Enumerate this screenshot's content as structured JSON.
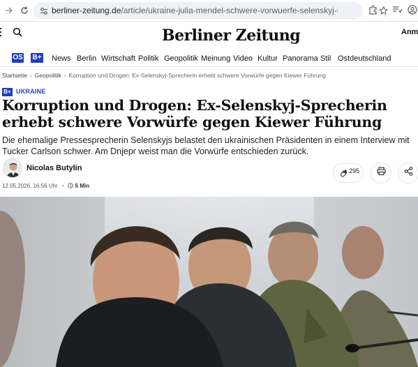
{
  "browser": {
    "url_host": "berliner-zeitung.de",
    "url_path": "/article/ukraine-julia-mendel-schwere-vorwuerfe-selenskyj-tucker-carlson-int..."
  },
  "site": {
    "logo": "Berliner Zeitung",
    "login_label": "Anme"
  },
  "nav": {
    "badge_os": "OS",
    "badge_b": "B+",
    "items": [
      "News",
      "Berlin",
      "Wirtschaft",
      "Politik",
      "Geopolitik",
      "Meinung",
      "Video",
      "Kultur",
      "Panorama",
      "Stil",
      "Ostdeutschland"
    ]
  },
  "breadcrumb": {
    "home": "Startseite",
    "section": "Geopolitik",
    "current": "Korruption und Drogen: Ex-Selenskyj-Sprecherin erhebt schwere Vorwürfe gegen Kiewer Führung"
  },
  "article": {
    "kicker_badge": "B+",
    "kicker": "UKRAINE",
    "headline": "Korruption und Drogen: Ex-Selenskyj-Sprecherin erhebt schwere Vorwürfe gegen Kiewer Führung",
    "teaser": "Die ehemalige Pressesprecherin Selenskyjs belastet den ukrainischen Präsidenten in einem Interview mit Tucker Carlson schwer. Am Dnjepr weist man die Vorwürfe entschieden zurück.",
    "author": "Nicolas Butylin",
    "claps": "295",
    "date": "12.05.2026, 16:56 Uhr",
    "read_time": "5 Min"
  },
  "colors": {
    "brand_blue": "#1f3fbf"
  }
}
